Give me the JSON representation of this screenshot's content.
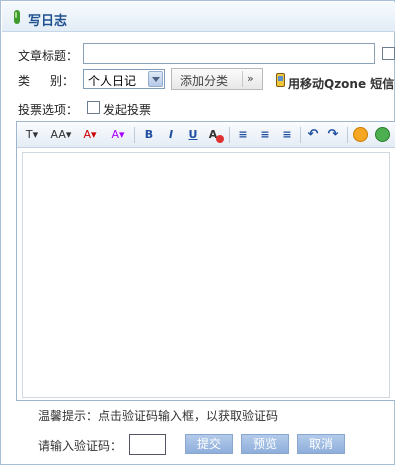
{
  "header": {
    "title": "写日志"
  },
  "form": {
    "title_label": "文章标题：",
    "title_value": "",
    "category_label_a": "类",
    "category_label_b": "别：",
    "category_selected": "个人日记",
    "add_category_label": "添加分类",
    "more_label": "»",
    "mobile_text": "用移动Qzone 短信",
    "vote_label": "投票选项：",
    "vote_checkbox_label": "发起投票"
  },
  "toolbar": {
    "items": [
      {
        "icon": "font-family-icon",
        "text": "T▾"
      },
      {
        "icon": "font-size-icon",
        "text": "AA▾"
      },
      {
        "icon": "font-color-icon",
        "text": "A▾"
      },
      {
        "icon": "highlight-icon",
        "text": "A▾"
      },
      {
        "icon": "bold-icon",
        "text": "B"
      },
      {
        "icon": "italic-icon",
        "text": "I"
      },
      {
        "icon": "underline-icon",
        "text": "U"
      },
      {
        "icon": "clear-format-icon",
        "text": "A"
      },
      {
        "icon": "align-left-icon",
        "text": "≡"
      },
      {
        "icon": "align-center-icon",
        "text": "≡"
      },
      {
        "icon": "align-right-icon",
        "text": "≡"
      },
      {
        "icon": "undo-icon",
        "text": "↶"
      },
      {
        "icon": "redo-icon",
        "text": "↷"
      },
      {
        "icon": "emoticon-icon",
        "text": ""
      },
      {
        "icon": "insert-image-icon",
        "text": ""
      }
    ],
    "colors": {
      "accent": "#1f4fa0",
      "emoticon": "#f5a623",
      "image": "#4caf50"
    }
  },
  "footer": {
    "tip": "温馨提示：点击验证码输入框，以获取验证码",
    "captcha_label": "请输入验证码：",
    "captcha_value": "",
    "submit_label": "提交",
    "preview_label": "预览",
    "cancel_label": "取消"
  }
}
